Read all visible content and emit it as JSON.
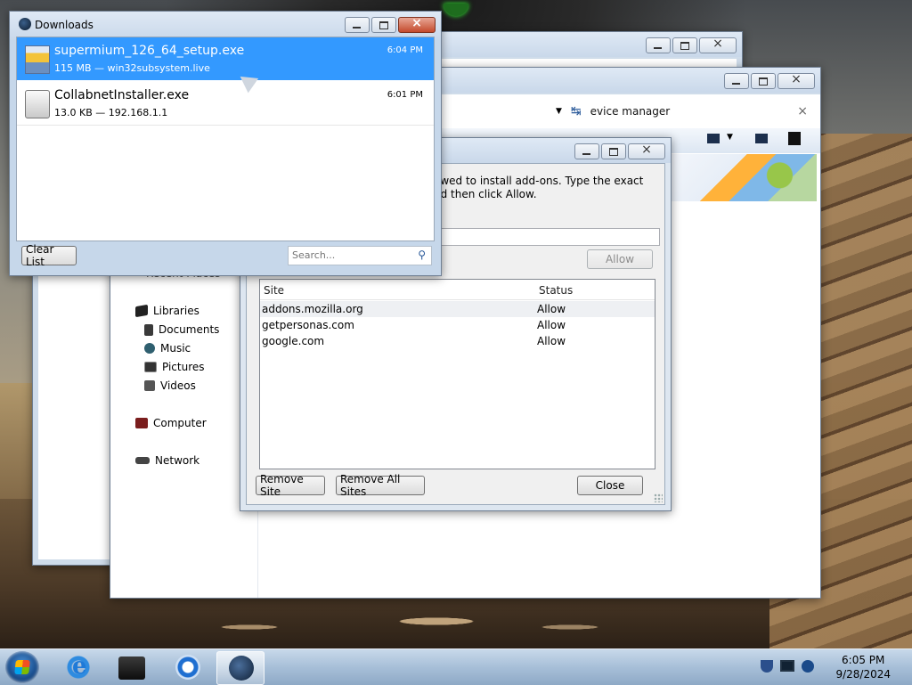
{
  "downloads": {
    "title": "Downloads",
    "items": [
      {
        "name": "supermium_126_64_setup.exe",
        "meta": "115 MB — win32subsystem.live",
        "time": "6:04 PM"
      },
      {
        "name": "CollabnetInstaller.exe",
        "meta": "13.0 KB — 192.168.1.1",
        "time": "6:01 PM"
      }
    ],
    "clear_label": "Clear List",
    "search_placeholder": "Search..."
  },
  "explorer": {
    "search_text": "evice manager",
    "nav": {
      "recent": "Recent Places",
      "libraries": "Libraries",
      "documents": "Documents",
      "music": "Music",
      "pictures": "Pictures",
      "videos": "Videos",
      "computer": "Computer",
      "network": "Network"
    }
  },
  "permissions": {
    "desc_line1": "owed to install add-ons. Type the exact",
    "desc_line2": "nd then click Allow.",
    "allow_label": "Allow",
    "columns": {
      "site": "Site",
      "status": "Status"
    },
    "rows": [
      {
        "site": "addons.mozilla.org",
        "status": "Allow"
      },
      {
        "site": "getpersonas.com",
        "status": "Allow"
      },
      {
        "site": "google.com",
        "status": "Allow"
      }
    ],
    "remove_site_label": "Remove Site",
    "remove_all_label": "Remove All Sites",
    "close_label": "Close"
  },
  "taskbar": {
    "time": "6:05 PM",
    "date": "9/28/2024"
  }
}
